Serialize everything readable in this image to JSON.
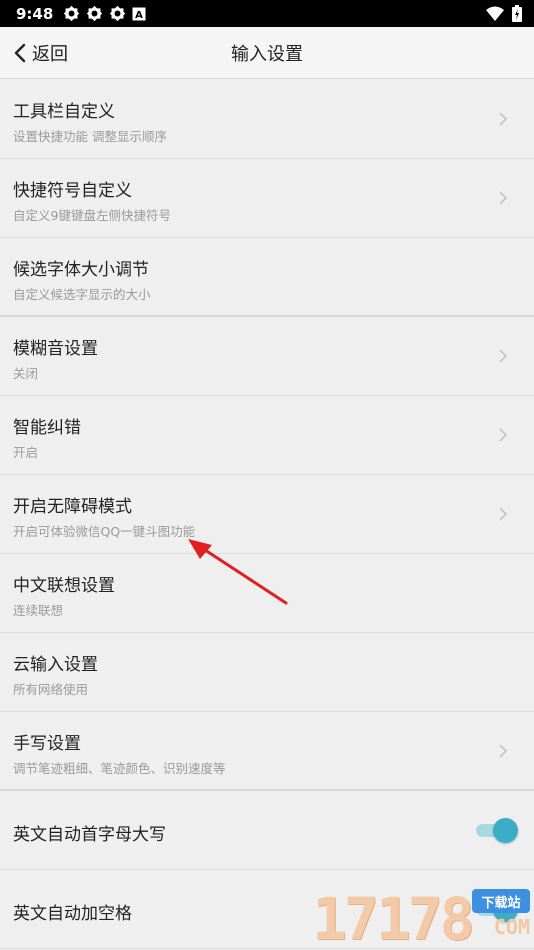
{
  "status_bar": {
    "time": "9:48",
    "left_icons": [
      "gear-icon",
      "gear-icon",
      "gear-icon",
      "a-box-icon"
    ],
    "right_icons": [
      "wifi-icon",
      "battery-icon"
    ]
  },
  "header": {
    "back_label": "返回",
    "title": "输入设置"
  },
  "items": [
    {
      "title": "工具栏自定义",
      "subtitle": "设置快捷功能 调整显示顺序",
      "control": "chevron"
    },
    {
      "title": "快捷符号自定义",
      "subtitle": "自定义9键键盘左侧快捷符号",
      "control": "chevron"
    },
    {
      "title": "候选字体大小调节",
      "subtitle": "自定义候选字显示的大小",
      "control": "none"
    },
    {
      "title": "模糊音设置",
      "subtitle": "关闭",
      "control": "chevron"
    },
    {
      "title": "智能纠错",
      "subtitle": "开启",
      "control": "chevron"
    },
    {
      "title": "开启无障碍模式",
      "subtitle": "开启可体验微信QQ一键斗图功能",
      "control": "chevron"
    },
    {
      "title": "中文联想设置",
      "subtitle": "连续联想",
      "control": "none"
    },
    {
      "title": "云输入设置",
      "subtitle": "所有网络使用",
      "control": "none"
    },
    {
      "title": "手写设置",
      "subtitle": "调节笔迹粗细、笔迹颜色、识别速度等",
      "control": "chevron"
    },
    {
      "title": "英文自动首字母大写",
      "subtitle": "",
      "control": "toggle",
      "toggle_on": true
    },
    {
      "title": "英文自动加空格",
      "subtitle": "",
      "control": "toggle",
      "toggle_on": true
    }
  ],
  "annotation": {
    "type": "red-arrow",
    "color": "#e02020"
  },
  "watermark": {
    "digits": "17178",
    "badge": "下载站",
    "suffix": "COM"
  },
  "colors": {
    "accent": "#3aaec7",
    "toggle_track": "#a8d9e3"
  }
}
